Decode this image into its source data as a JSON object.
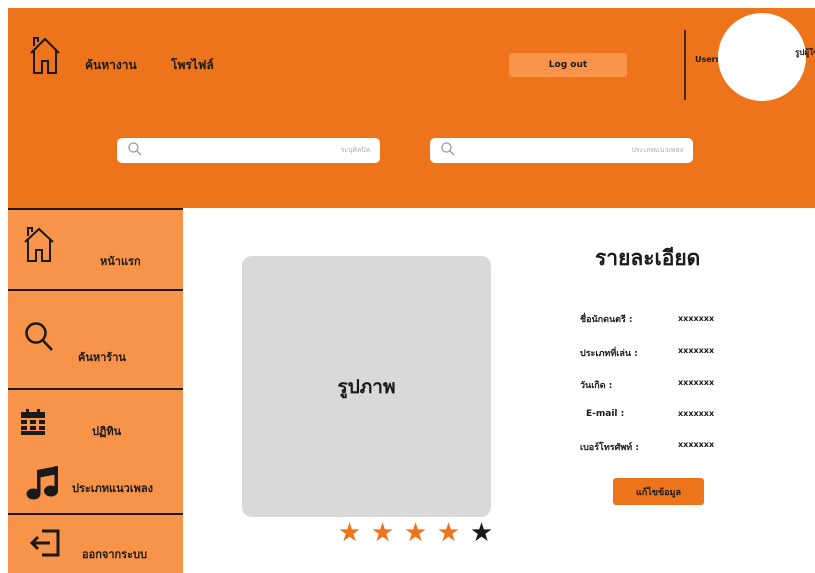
{
  "header": {
    "nav_search_jobs": "ค้นหางาน",
    "nav_profile": "โพรไฟล์",
    "logout_label": "Log out",
    "username": "Username",
    "avatar_label": "รูปผู้ใช้",
    "search_artist_placeholder": "ระบุศิลปิล",
    "search_genre_placeholder": "ประเภทแนวเพลง"
  },
  "sidebar": {
    "items": [
      {
        "label": "หน้าแรก",
        "icon": "home-icon"
      },
      {
        "label": "ค้นหาร้าน",
        "icon": "search-icon"
      },
      {
        "label": "ปฏิทิน",
        "icon": "calendar-icon"
      },
      {
        "label": "ประเภทแนวเพลง",
        "icon": "music-note-icon"
      },
      {
        "label": "ออกจากระบบ",
        "icon": "logout-icon"
      }
    ]
  },
  "main": {
    "image_label": "รูปภาพ",
    "rating": {
      "value": 4,
      "max": 5
    },
    "details_title": "รายละเอียด",
    "fields": [
      {
        "label": "ชื่อนักดนตรี :",
        "value": "xxxxxxx"
      },
      {
        "label": "ประเภทที่เล่น :",
        "value": "xxxxxxx"
      },
      {
        "label": "วันเกิด :",
        "value": "xxxxxxx"
      },
      {
        "label": "E-mail :",
        "value": "xxxxxxx"
      },
      {
        "label": "เบอร์โทรศัพท์ :",
        "value": "xxxxxxx"
      }
    ],
    "edit_button_label": "แก้ไขข้อมูล"
  },
  "colors": {
    "header_bg": "#ED741B",
    "sidebar_bg": "#F7944A",
    "image_bg": "#D9D9D9",
    "star_filled": "#ED741B",
    "star_empty": "#1a1a1a"
  }
}
